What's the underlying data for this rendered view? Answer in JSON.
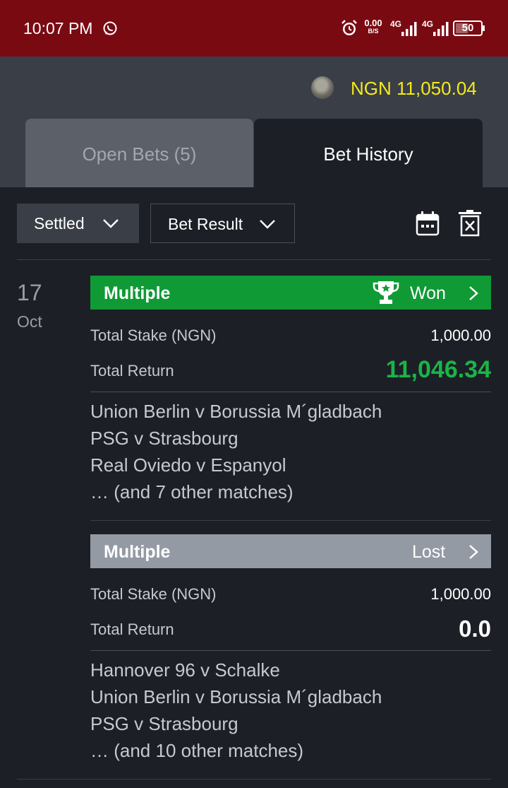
{
  "status_bar": {
    "time": "10:07 PM",
    "net_speed": "0.00",
    "net_unit": "B/S",
    "signal1_label": "4G",
    "signal2_label": "4G",
    "battery": "50"
  },
  "header": {
    "balance": "NGN 11,050.04",
    "balance_color": "#f3ea1c"
  },
  "tabs": [
    {
      "label": "Open Bets (5)",
      "active": false
    },
    {
      "label": "Bet History",
      "active": true
    }
  ],
  "filters": {
    "status_label": "Settled",
    "result_label": "Bet Result"
  },
  "date": {
    "day": "17",
    "month": "Oct"
  },
  "bets": [
    {
      "type": "Multiple",
      "result": "Won",
      "result_color": "#0f9a35",
      "stake_label": "Total Stake (NGN)",
      "stake": "1,000.00",
      "return_label": "Total Return",
      "return": "11,046.34",
      "matches": [
        "Union Berlin v Borussia M´gladbach",
        "PSG v Strasbourg",
        "Real Oviedo v Espanyol",
        "… (and 7 other matches)"
      ]
    },
    {
      "type": "Multiple",
      "result": "Lost",
      "result_color": "#949aa4",
      "stake_label": "Total Stake (NGN)",
      "stake": "1,000.00",
      "return_label": "Total Return",
      "return": "0.0",
      "matches": [
        "Hannover 96 v Schalke",
        "Union Berlin v Borussia M´gladbach",
        "PSG v Strasbourg",
        "… (and 10 other matches)"
      ]
    }
  ],
  "icons": {
    "whatsapp": "whatsapp-icon",
    "alarm": "alarm-icon",
    "calendar": "calendar-icon",
    "clear": "clear-filter-icon",
    "trophy": "trophy-icon",
    "chevron": "chevron-right-icon"
  }
}
